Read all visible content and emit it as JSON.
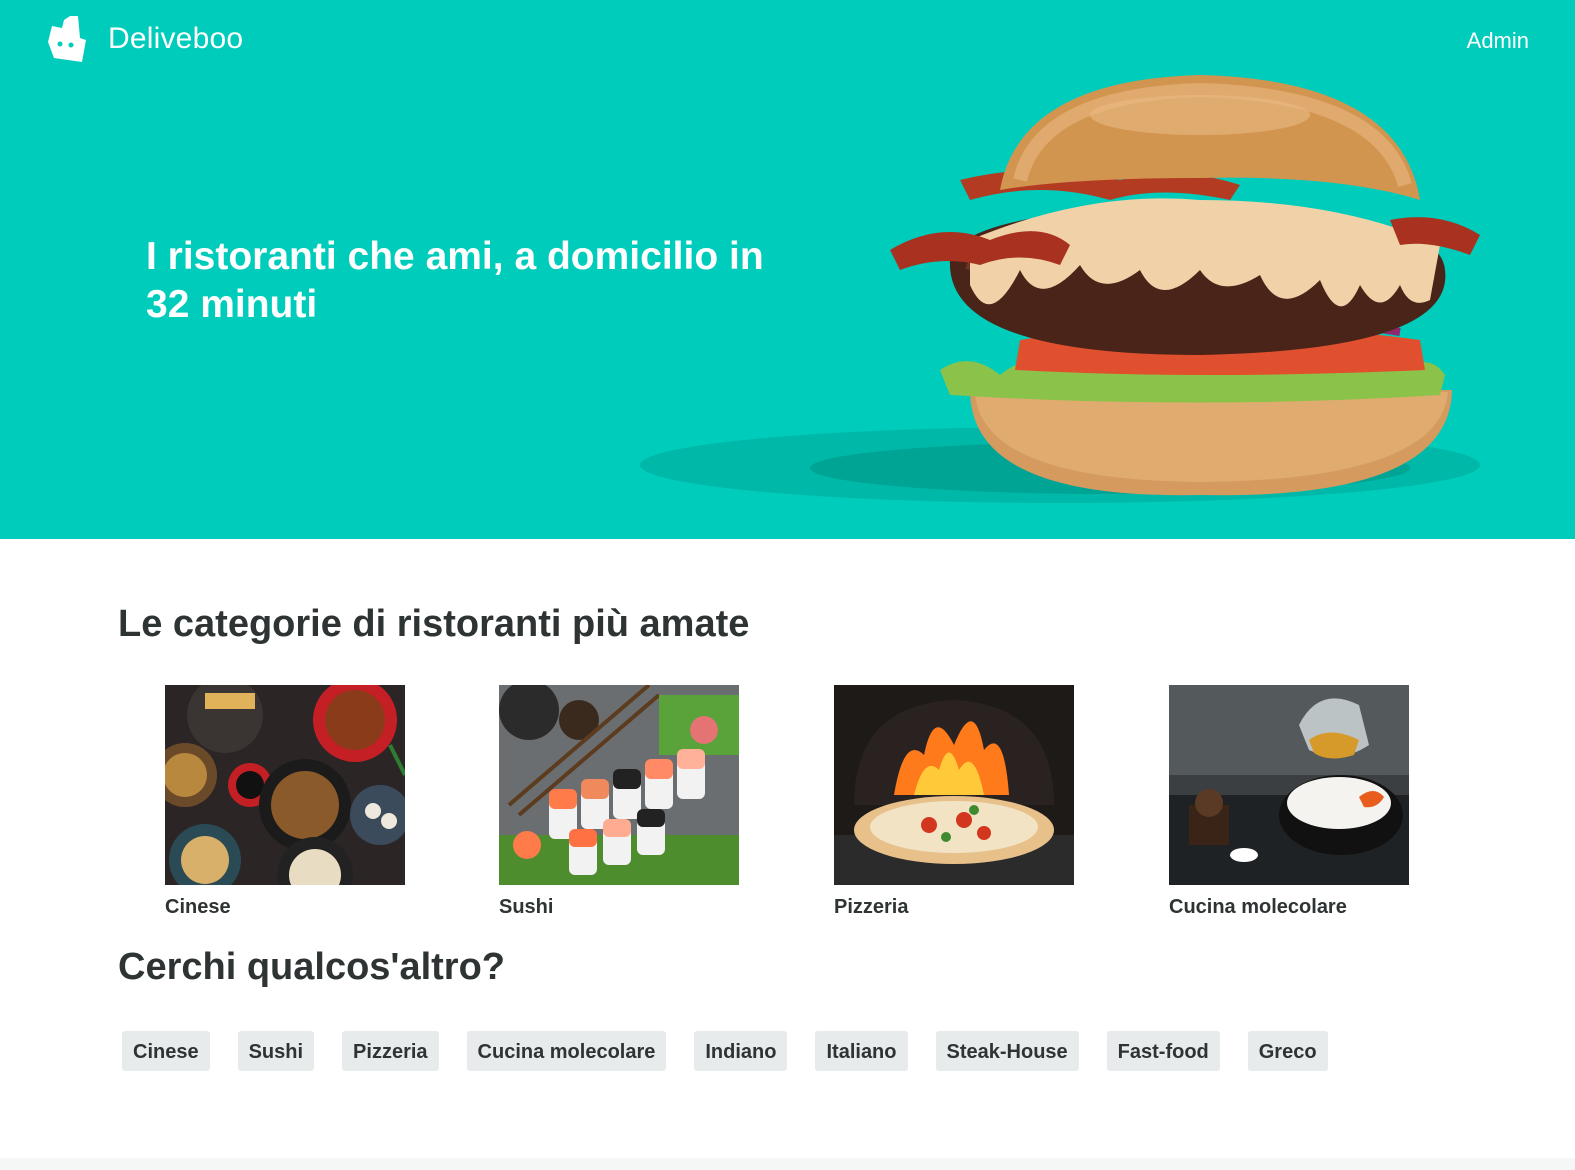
{
  "header": {
    "brand": "Deliveboo",
    "admin_label": "Admin"
  },
  "hero": {
    "tagline": "I ristoranti che ami, a domicilio in 32 minuti",
    "background_color": "#00ccbc"
  },
  "categories": {
    "title": "Le categorie di ristoranti più amate",
    "items": [
      {
        "label": "Cinese"
      },
      {
        "label": "Sushi"
      },
      {
        "label": "Pizzeria"
      },
      {
        "label": "Cucina molecolare"
      }
    ]
  },
  "other": {
    "title": "Cerchi qualcos'altro?",
    "tags": [
      "Cinese",
      "Sushi",
      "Pizzeria",
      "Cucina molecolare",
      "Indiano",
      "Italiano",
      "Steak-House",
      "Fast-food",
      "Greco"
    ]
  },
  "colors": {
    "accent": "#00ccbc",
    "text": "#2e3333",
    "tag_bg": "#e8ebeb"
  }
}
